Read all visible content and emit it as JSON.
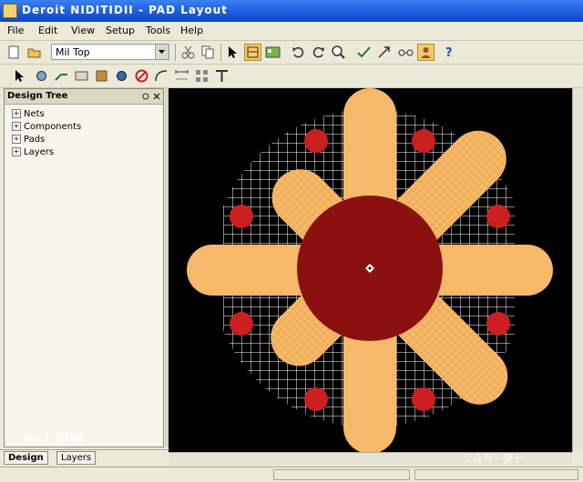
{
  "window": {
    "title": "Deroit NIDITIDII - PAD Layout"
  },
  "menu": {
    "items": [
      {
        "label": "File"
      },
      {
        "label": "Edit"
      },
      {
        "label": "View"
      },
      {
        "label": "Setup"
      },
      {
        "label": "Tools"
      },
      {
        "label": "Help"
      }
    ]
  },
  "toolbar": {
    "layout_combo_value": "Mil Top"
  },
  "panel": {
    "title": "Design Tree",
    "tree_items": [
      {
        "label": "Nets"
      },
      {
        "label": "Components"
      },
      {
        "label": "Pads"
      },
      {
        "label": "Layers"
      }
    ]
  },
  "bottom_tabs": [
    {
      "label": "Design"
    },
    {
      "label": "Layers"
    }
  ],
  "watermarks": {
    "logo_text": "Bai  百科",
    "corner_text": "公众号 · 硬十"
  },
  "colors": {
    "canvas_bg": "#000000",
    "pad_fill": "#f6b96a",
    "center_pad": "#8b1111",
    "drill_hole": "#cc1f1f",
    "grid": "#ffffff",
    "title_bar": "#1a5ad8"
  }
}
